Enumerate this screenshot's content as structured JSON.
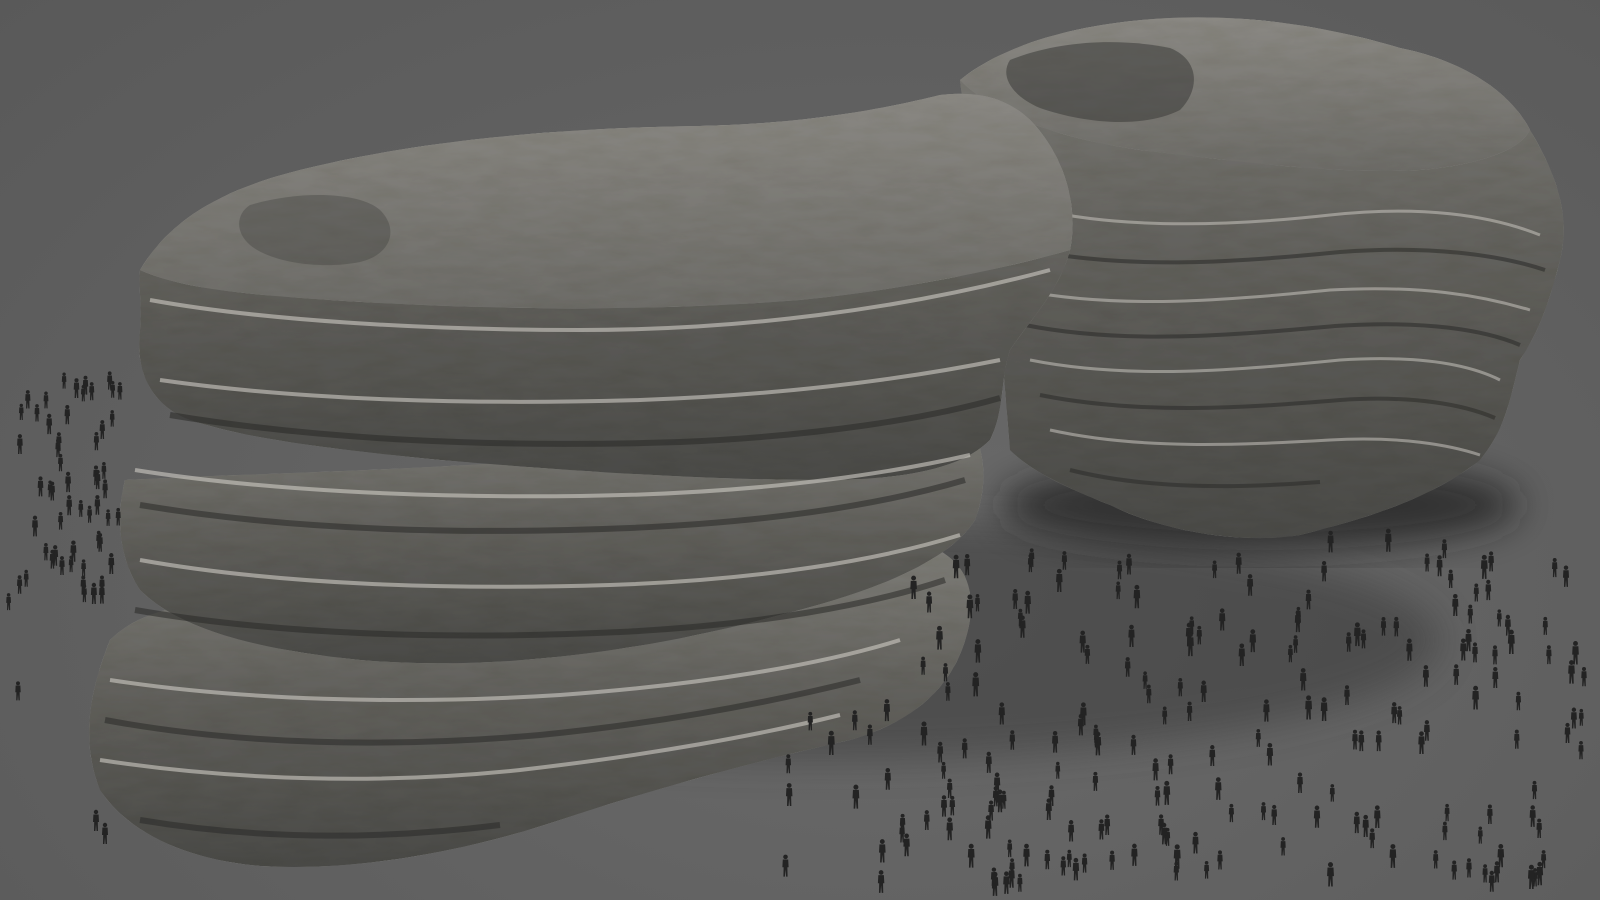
{
  "scene": {
    "subject": "rock-formation-render",
    "ground_color": "#626262",
    "rock_colors": {
      "base": "#6f6f6c",
      "light": "#bdbab3",
      "dark": "#2f2f2e",
      "moss": "#5c6148"
    },
    "figure_color": "#222222",
    "icons": [
      "rock-formation",
      "person-silhouette"
    ]
  }
}
